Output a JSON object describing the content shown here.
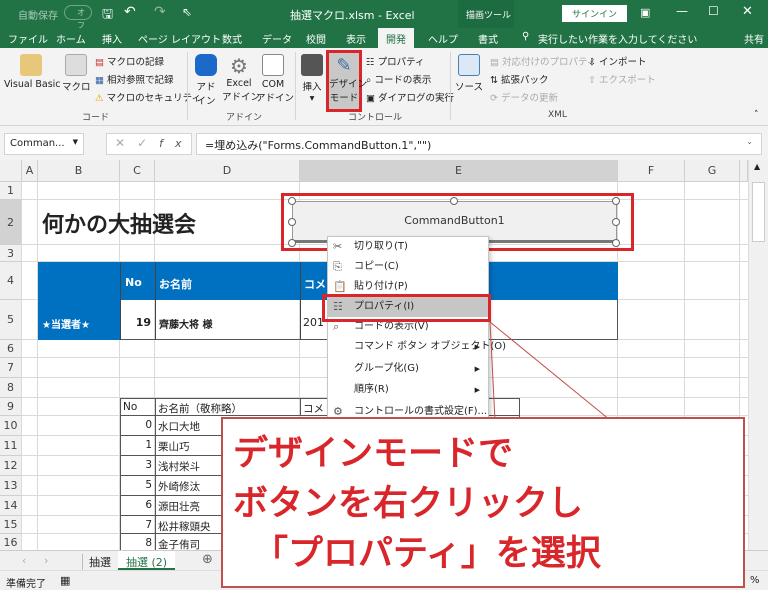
{
  "title_bar": {
    "autosave": "自動保存",
    "autosave_state": "オフ",
    "file_title": "抽選マクロ.xlsm - Excel",
    "context_tool": "描画ツール",
    "signin": "サインイン"
  },
  "tabs": [
    "ファイル",
    "ホーム",
    "挿入",
    "ページ レイアウト",
    "数式",
    "データ",
    "校閲",
    "表示",
    "開発",
    "ヘルプ",
    "書式"
  ],
  "active_tab": "開発",
  "tell_me": "実行したい作業を入力してください",
  "share": "共有",
  "ribbon": {
    "code": {
      "label": "コード",
      "visual_basic": "Visual Basic",
      "macro": "マクロ",
      "record": "マクロの記録",
      "relative": "相対参照で記録",
      "security": "マクロのセキュリティ"
    },
    "addin": {
      "label": "アドイン",
      "addin1": "アド",
      "addin2": "イン",
      "excel1": "Excel",
      "excel2": "アドイン",
      "com1": "COM",
      "com2": "アドイン"
    },
    "control": {
      "label": "コントロール",
      "insert": "挿入",
      "design1": "デザイン",
      "design2": "モード",
      "properties": "プロパティ",
      "view_code": "コードの表示",
      "run_dialog": "ダイアログの実行"
    },
    "xml": {
      "label": "XML",
      "source": "ソース",
      "map_props": "対応付けのプロパティ",
      "expansion": "拡張パック",
      "refresh": "データの更新",
      "import": "インポート",
      "export": "エクスポート"
    }
  },
  "name_box": "Comman...",
  "formula": "=埋め込み(\"Forms.CommandButton.1\",\"\")",
  "columns": [
    "A",
    "B",
    "C",
    "D",
    "E",
    "F",
    "G"
  ],
  "rows": [
    "1",
    "2",
    "3",
    "4",
    "5",
    "6",
    "7",
    "8",
    "9",
    "10",
    "11",
    "12",
    "13",
    "14",
    "15",
    "16"
  ],
  "sheet": {
    "title": "何かの大抽選会",
    "button": "CommandButton1",
    "hdr_no": "No",
    "hdr_name": "お名前",
    "hdr_comment": "コメ",
    "winner_label": "★当選者★",
    "winner_no": "19",
    "winner_name": "齊藤大将 様",
    "winner_comment": "201",
    "list_hdr_no": "No",
    "list_hdr_name": "お名前（敬称略）",
    "list_hdr_comment": "コメ",
    "list": [
      {
        "no": "0",
        "name": "水口大地"
      },
      {
        "no": "1",
        "name": "栗山巧"
      },
      {
        "no": "3",
        "name": "浅村栄斗"
      },
      {
        "no": "5",
        "name": "外崎修汰"
      },
      {
        "no": "6",
        "name": "源田壮亮"
      },
      {
        "no": "7",
        "name": "松井稼頭央"
      },
      {
        "no": "8",
        "name": "金子侑司"
      }
    ]
  },
  "context_menu": [
    {
      "label": "切り取り(T)",
      "icon": "scissors-icon"
    },
    {
      "label": "コピー(C)",
      "icon": "copy-icon"
    },
    {
      "label": "貼り付け(P)",
      "icon": "paste-icon"
    },
    {
      "label": "プロパティ(I)",
      "icon": "properties-icon"
    },
    {
      "label": "コードの表示(V)",
      "icon": "view-code-icon"
    },
    {
      "label": "コマンド ボタン オブジェクト(O)",
      "sub": true
    },
    {
      "label": "グループ化(G)",
      "sub": true
    },
    {
      "label": "順序(R)",
      "sub": true
    },
    {
      "label": "コントロールの書式設定(F)...",
      "icon": "format-control-icon"
    }
  ],
  "sheet_tabs": [
    "抽選",
    "抽選 (2)"
  ],
  "active_sheet": "抽選 (2)",
  "status": "準備完了",
  "zoom_suffix": "%",
  "callout": [
    "デザインモードで",
    "ボタンを右クリックし",
    "「プロパティ」を選択"
  ],
  "colors": {
    "excel_green": "#217346",
    "header_blue": "#0070c0",
    "highlight_red": "#d9262b"
  }
}
